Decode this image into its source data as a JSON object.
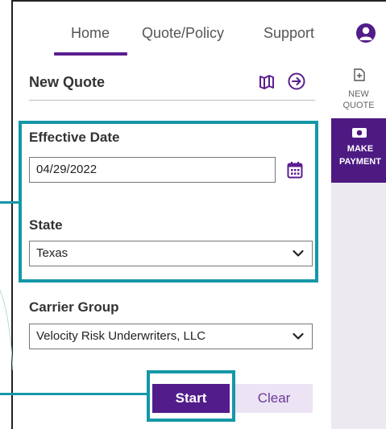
{
  "nav": {
    "items": [
      {
        "label": "Home",
        "active": true
      },
      {
        "label": "Quote/Policy",
        "active": false
      },
      {
        "label": "Support",
        "active": false
      }
    ]
  },
  "panel": {
    "title": "New Quote"
  },
  "rail": {
    "new_quote_label_1": "NEW",
    "new_quote_label_2": "QUOTE",
    "make_payment_label_1": "MAKE",
    "make_payment_label_2": "PAYMENT"
  },
  "form": {
    "effective_date": {
      "label": "Effective Date",
      "value": "04/29/2022"
    },
    "state": {
      "label": "State",
      "value": "Texas"
    },
    "carrier_group": {
      "label": "Carrier Group",
      "value": "Velocity Risk Underwriters, LLC"
    }
  },
  "buttons": {
    "start_label": "Start",
    "clear_label": "Clear"
  },
  "colors": {
    "brand_purple": "#521d8a",
    "highlight_teal": "#1597a8",
    "rail_background": "#ede9f1"
  },
  "icons": [
    "user-avatar-icon",
    "map-icon",
    "arrow-circle-right-icon",
    "calendar-icon",
    "chevron-down-icon",
    "new-document-icon",
    "payment-card-icon"
  ]
}
